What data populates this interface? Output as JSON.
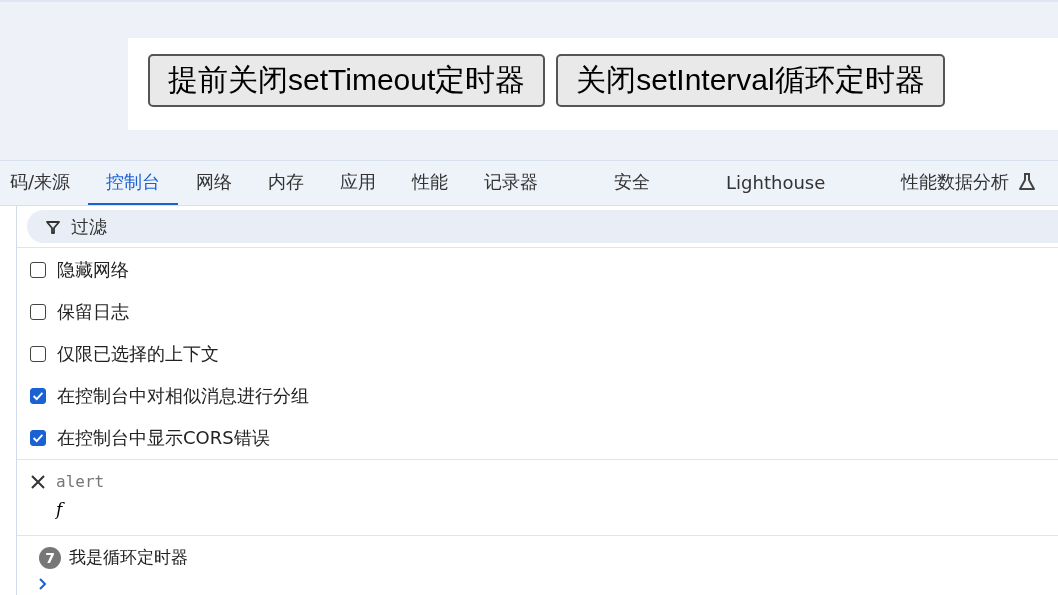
{
  "page": {
    "buttons": [
      {
        "label": "提前关闭setTimeout定时器"
      },
      {
        "label": "关闭setInterval循环定时器"
      }
    ]
  },
  "devtools": {
    "tabs": [
      {
        "label": "码/来源",
        "selected": false
      },
      {
        "label": "控制台",
        "selected": true
      },
      {
        "label": "网络",
        "selected": false
      },
      {
        "label": "内存",
        "selected": false
      },
      {
        "label": "应用",
        "selected": false
      },
      {
        "label": "性能",
        "selected": false
      },
      {
        "label": "记录器",
        "selected": false
      },
      {
        "label": "安全",
        "selected": false
      },
      {
        "label": "Lighthouse",
        "selected": false
      },
      {
        "label": "性能数据分析",
        "selected": false,
        "experimental": true
      }
    ],
    "filter": {
      "placeholder": "过滤"
    },
    "settings": [
      {
        "label": "隐藏网络",
        "checked": false
      },
      {
        "label": "保留日志",
        "checked": false
      },
      {
        "label": "仅限已选择的上下文",
        "checked": false
      },
      {
        "label": "在控制台中对相似消息进行分组",
        "checked": true
      },
      {
        "label": "在控制台中显示CORS错误",
        "checked": true
      }
    ],
    "console": [
      {
        "kind": "closed",
        "text": "alert",
        "detail": "f"
      },
      {
        "kind": "repeated",
        "count": "7",
        "text": "我是循环定时器"
      }
    ]
  }
}
